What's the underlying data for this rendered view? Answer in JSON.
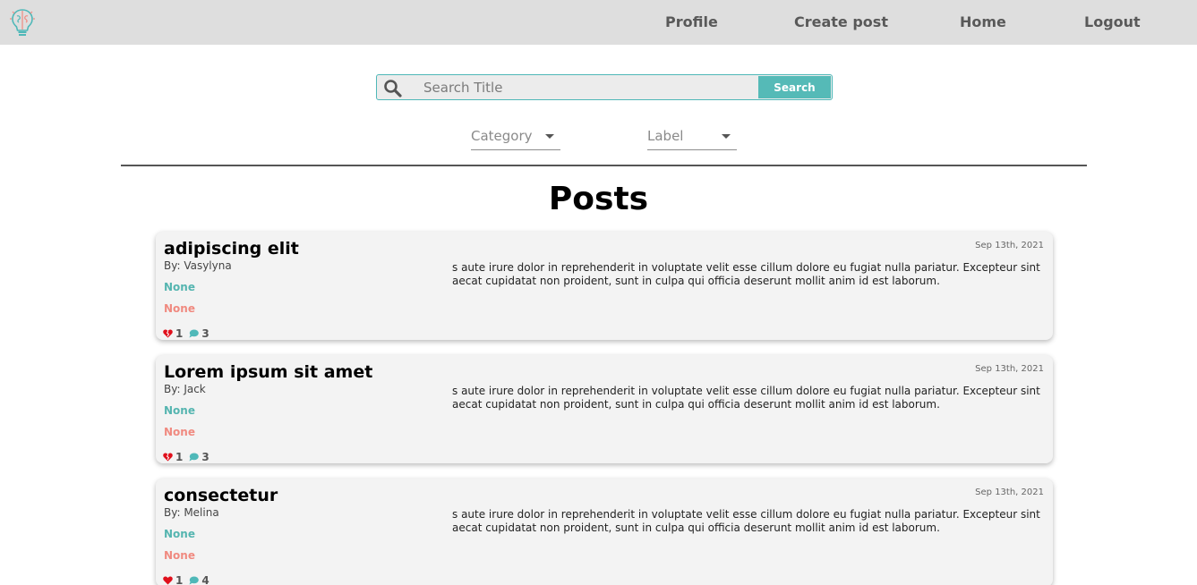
{
  "nav": {
    "links": [
      "Profile",
      "Create post",
      "Home",
      "Logout"
    ],
    "logo_icon": "lightbulb-brain-icon"
  },
  "search": {
    "placeholder": "Search Title",
    "value": "",
    "button_label": "Search",
    "icon": "search-icon"
  },
  "filters": {
    "category_label": "Category",
    "label_label": "Label"
  },
  "page_title": "Posts",
  "posts": [
    {
      "title": "adipiscing elit",
      "author": "By: Vasylyna",
      "category": "None",
      "label": "None",
      "likes": "1",
      "comments": "3",
      "date": "Sep 13th, 2021",
      "body": "s aute irure dolor in reprehenderit in voluptate velit esse cillum dolore eu fugiat nulla pariatur. Excepteur sint aecat cupidatat non proident, sunt in culpa qui officia deserunt mollit anim id est laborum.",
      "like_icon": "broken-heart-icon"
    },
    {
      "title": "Lorem ipsum sit amet",
      "author": "By: Jack",
      "category": "None",
      "label": "None",
      "likes": "1",
      "comments": "3",
      "date": "Sep 13th, 2021",
      "body": "s aute irure dolor in reprehenderit in voluptate velit esse cillum dolore eu fugiat nulla pariatur. Excepteur sint aecat cupidatat non proident, sunt in culpa qui officia deserunt mollit anim id est laborum.",
      "like_icon": "broken-heart-icon"
    },
    {
      "title": "consectetur",
      "author": "By: Melina",
      "category": "None",
      "label": "None",
      "likes": "1",
      "comments": "4",
      "date": "Sep 13th, 2021",
      "body": "s aute irure dolor in reprehenderit in voluptate velit esse cillum dolore eu fugiat nulla pariatur. Excepteur sint aecat cupidatat non proident, sunt in culpa qui officia deserunt mollit anim id est laborum.",
      "like_icon": "heart-icon"
    }
  ],
  "colors": {
    "accent": "#55bab7",
    "category": "#55b5b0",
    "label": "#f08a80",
    "like": "#e0101c",
    "navbar": "#dedede",
    "card": "#f3f3f3"
  }
}
